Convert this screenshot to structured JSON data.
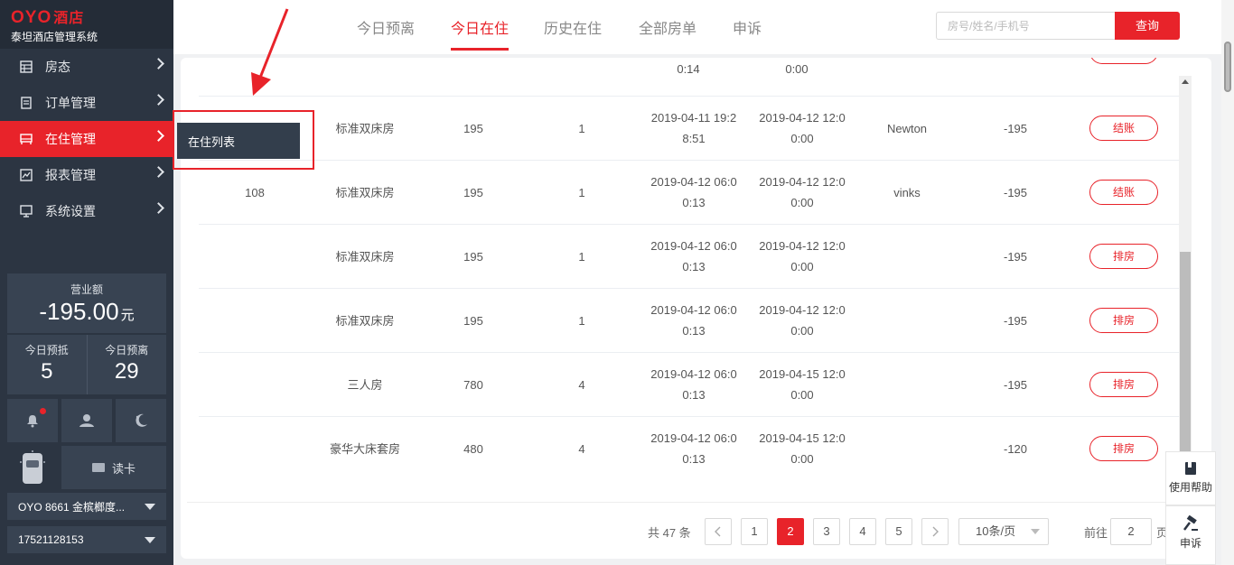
{
  "brand": {
    "logo": "OYO",
    "logo_suffix": "酒店",
    "system_name": "泰坦酒店管理系统"
  },
  "sidebar": {
    "items": [
      {
        "label": "房态",
        "icon": "grid-icon"
      },
      {
        "label": "订单管理",
        "icon": "document-icon"
      },
      {
        "label": "在住管理",
        "icon": "bed-icon",
        "active": true
      },
      {
        "label": "报表管理",
        "icon": "chart-icon"
      },
      {
        "label": "系统设置",
        "icon": "monitor-icon"
      }
    ],
    "submenu": {
      "label": "在住列表"
    },
    "revenue": {
      "label": "营业额",
      "value": "-195.00",
      "unit": "元"
    },
    "today_arrive": {
      "label": "今日预抵",
      "value": "5"
    },
    "today_depart": {
      "label": "今日预离",
      "value": "29"
    },
    "read_card": "读卡",
    "hotel_select": "OYO 8661 金槟榔度...",
    "phone_select": "17521128153"
  },
  "tabs": [
    {
      "label": "今日预离"
    },
    {
      "label": "今日在住",
      "active": true
    },
    {
      "label": "历史在住"
    },
    {
      "label": "全部房单"
    },
    {
      "label": "申诉"
    }
  ],
  "search": {
    "placeholder": "房号/姓名/手机号",
    "button": "查询"
  },
  "table": {
    "partial_top": {
      "checkin_tail": "0:14",
      "checkout_tail": "0:00"
    },
    "rows": [
      {
        "room": "",
        "type": "标准双床房",
        "price": "195",
        "count": "1",
        "checkin1": "2019-04-11 19:2",
        "checkin2": "8:51",
        "checkout1": "2019-04-12 12:0",
        "checkout2": "0:00",
        "guest": "Newton",
        "balance": "-195",
        "action": "结账"
      },
      {
        "room": "108",
        "type": "标准双床房",
        "price": "195",
        "count": "1",
        "checkin1": "2019-04-12 06:0",
        "checkin2": "0:13",
        "checkout1": "2019-04-12 12:0",
        "checkout2": "0:00",
        "guest": "vinks",
        "balance": "-195",
        "action": "结账"
      },
      {
        "room": "",
        "type": "标准双床房",
        "price": "195",
        "count": "1",
        "checkin1": "2019-04-12 06:0",
        "checkin2": "0:13",
        "checkout1": "2019-04-12 12:0",
        "checkout2": "0:00",
        "guest": "",
        "balance": "-195",
        "action": "排房"
      },
      {
        "room": "",
        "type": "标准双床房",
        "price": "195",
        "count": "1",
        "checkin1": "2019-04-12 06:0",
        "checkin2": "0:13",
        "checkout1": "2019-04-12 12:0",
        "checkout2": "0:00",
        "guest": "",
        "balance": "-195",
        "action": "排房"
      },
      {
        "room": "",
        "type": "三人房",
        "price": "780",
        "count": "4",
        "checkin1": "2019-04-12 06:0",
        "checkin2": "0:13",
        "checkout1": "2019-04-15 12:0",
        "checkout2": "0:00",
        "guest": "",
        "balance": "-195",
        "action": "排房"
      },
      {
        "room": "",
        "type": "豪华大床套房",
        "price": "480",
        "count": "4",
        "checkin1": "2019-04-12 06:0",
        "checkin2": "0:13",
        "checkout1": "2019-04-15 12:0",
        "checkout2": "0:00",
        "guest": "",
        "balance": "-120",
        "action": "排房"
      }
    ]
  },
  "pagination": {
    "total": "共 47 条",
    "pages": [
      "1",
      "2",
      "3",
      "4",
      "5"
    ],
    "current": "2",
    "page_size": "10条/页",
    "goto_label": "前往",
    "goto_value": "2",
    "page_word": "页"
  },
  "float": {
    "help": "使用帮助",
    "appeal": "申诉"
  },
  "colors": {
    "accent": "#e8232a",
    "sidebar": "#2c3542"
  }
}
